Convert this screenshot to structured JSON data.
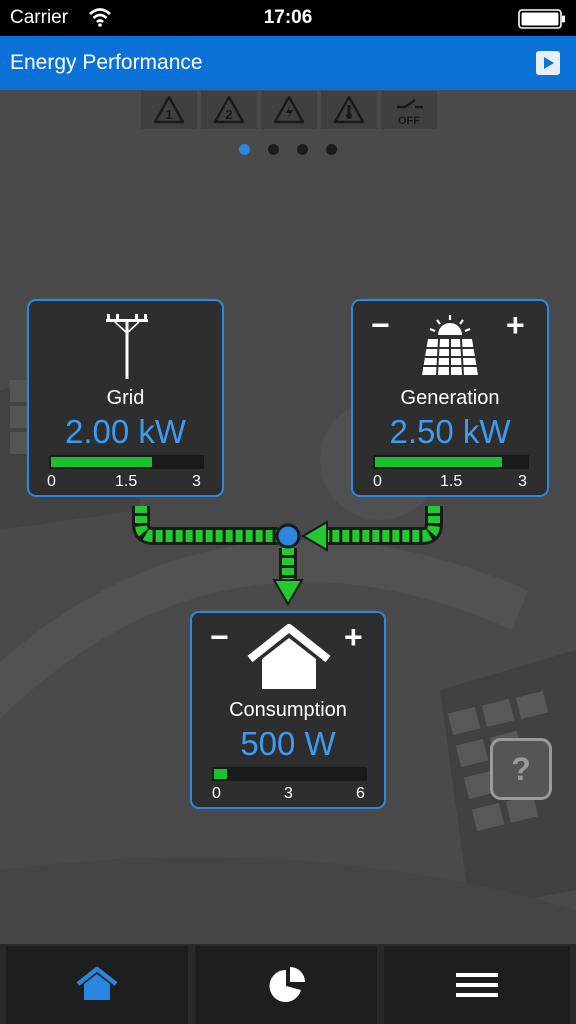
{
  "status_bar": {
    "carrier": "Carrier",
    "time": "17:06"
  },
  "header": {
    "title": "Energy Performance",
    "play_icon": "play-icon"
  },
  "alarm_icons": [
    "alarm-1-icon",
    "alarm-2-icon",
    "electric-warning-icon",
    "temperature-warning-icon",
    "switch-off-icon"
  ],
  "switch_off_label": "OFF",
  "page_indicator": {
    "total": 4,
    "active": 1
  },
  "grid": {
    "label": "Grid",
    "value": "2.00 kW",
    "level": 0.667,
    "scale": [
      "0",
      "1.5",
      "3"
    ]
  },
  "generation": {
    "label": "Generation",
    "value": "2.50 kW",
    "level": 0.833,
    "scale": [
      "0",
      "1.5",
      "3"
    ],
    "minus": "−",
    "plus": "+"
  },
  "consumption": {
    "label": "Consumption",
    "value": "500 W",
    "level": 0.083,
    "scale": [
      "0",
      "3",
      "6"
    ],
    "minus": "−",
    "plus": "+"
  },
  "help": {
    "label": "?"
  },
  "tabs": [
    "home-icon",
    "pie-chart-icon",
    "menu-icon"
  ],
  "colors": {
    "accent": "#0a72d6",
    "value_blue": "#3d9cf0",
    "card_border": "#2f88e0",
    "bar_green": "#19c12f",
    "arrow_green": "#22c92f"
  }
}
